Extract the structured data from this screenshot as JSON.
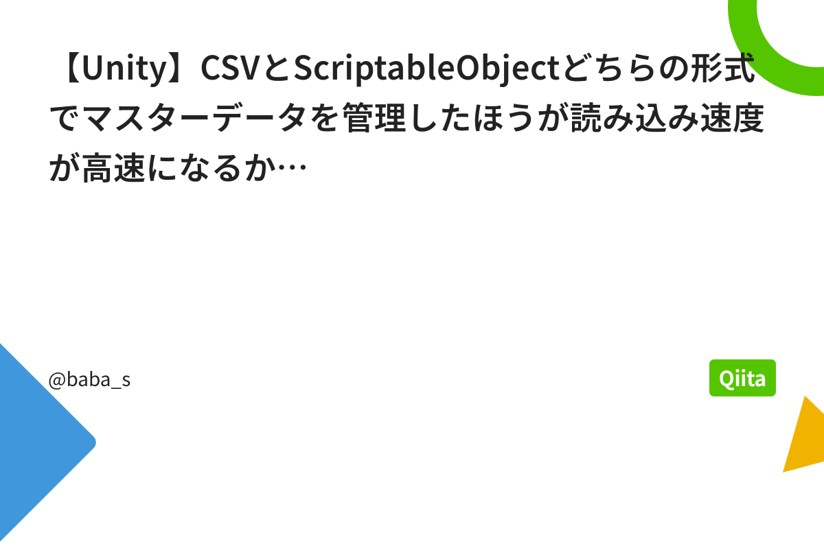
{
  "article": {
    "title": "【Unity】CSVとScriptableObjectどちらの形式でマスターデータを管理したほうが読み込み速度が高速になるか…",
    "author": "@baba_s"
  },
  "brand": {
    "logo_text": "Qiita",
    "accent_color": "#55c500"
  }
}
